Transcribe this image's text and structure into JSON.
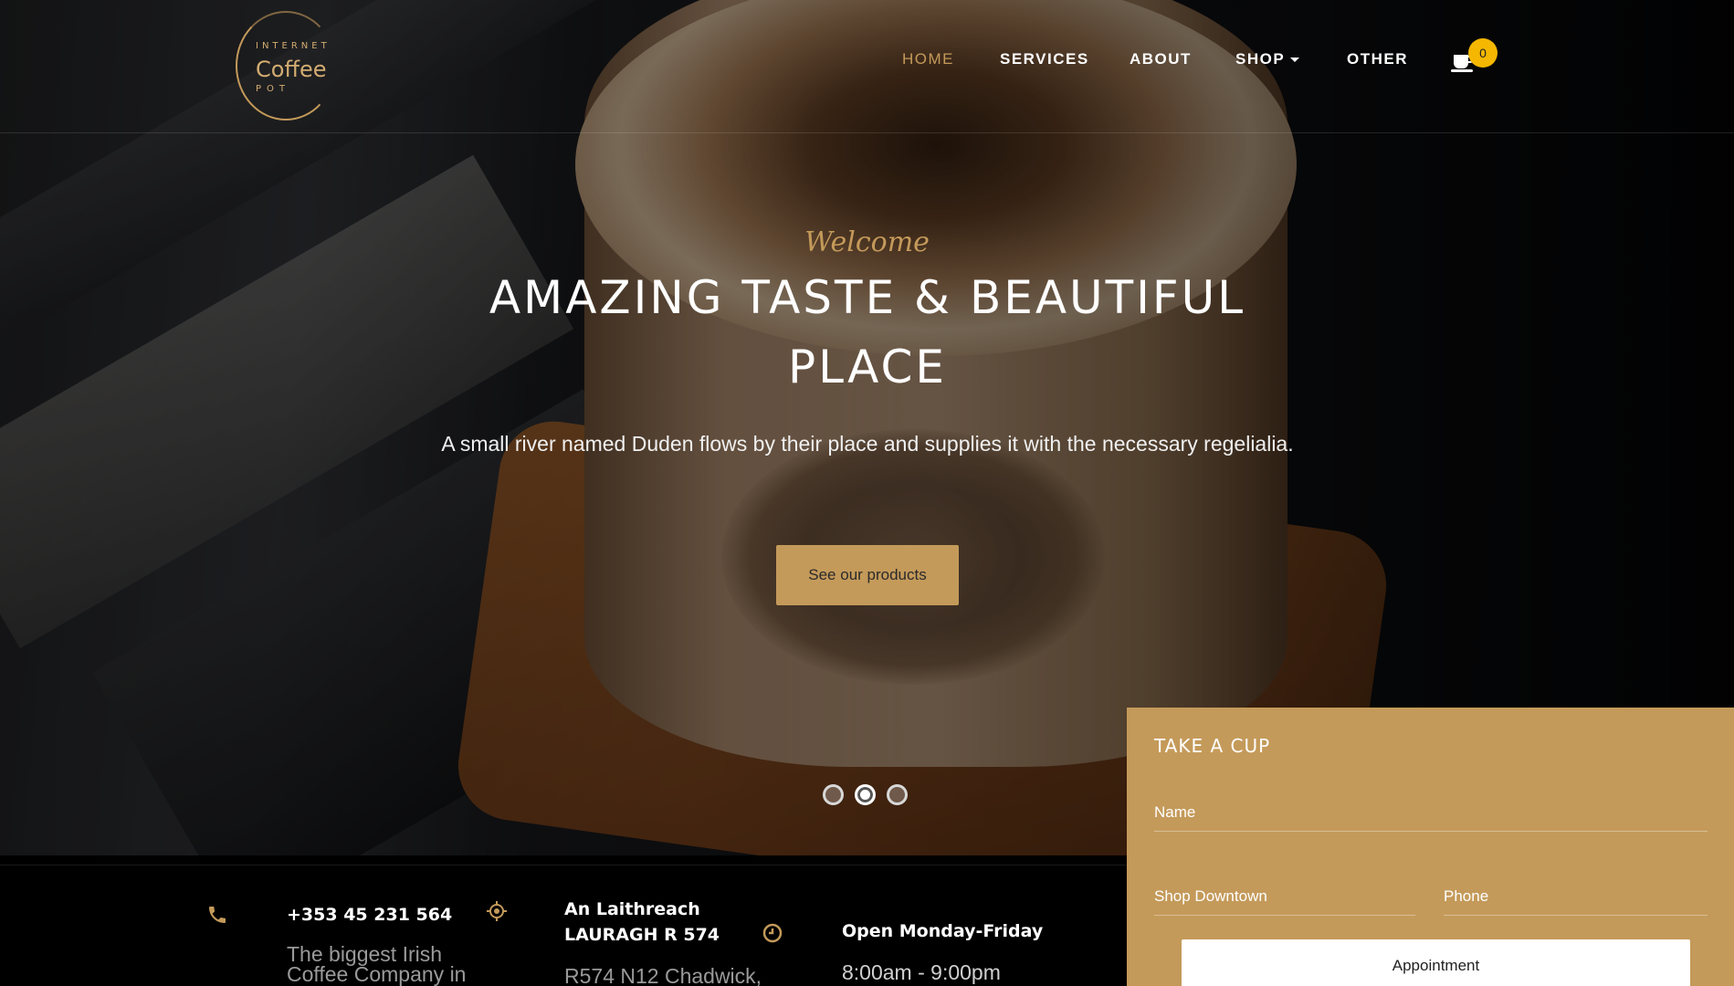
{
  "brand": {
    "line1": "INTERNET",
    "line2": "Coffee",
    "line3": "POT"
  },
  "nav": {
    "items": [
      {
        "label": "HOME"
      },
      {
        "label": "SERVICES"
      },
      {
        "label": "ABOUT"
      },
      {
        "label": "SHOP"
      },
      {
        "label": "OTHER"
      }
    ],
    "active": "HOME",
    "cart_count": "0"
  },
  "hero": {
    "welcome": "Welcome",
    "headline": "AMAZING TASTE & BEAUTIFUL PLACE",
    "subtitle": "A small river named Duden flows by their place and supplies it with the necessary regelialia.",
    "cta_label": "See our products",
    "slides_total": 3,
    "active_slide": 2
  },
  "info": {
    "phone": {
      "icon": "phone-icon",
      "number": "+353 45 231 564",
      "tagline": "The biggest Irish Coffee Company in the World"
    },
    "address": {
      "icon": "location-icon",
      "line1": "An Laithreach",
      "line2": "LAURAGH R 574",
      "line3": "R574 N12 Chadwick,"
    },
    "hours": {
      "icon": "clock-icon",
      "title": "Open Monday-Friday",
      "time": "8:00am - 9:00pm"
    }
  },
  "booking": {
    "title": "TAKE A CUP",
    "name_placeholder": "Name",
    "shop_placeholder": "Shop Downtown",
    "phone_placeholder": "Phone",
    "button_label": "Appointment"
  },
  "colors": {
    "accent": "#c49a5a",
    "badge": "#f5b700",
    "background": "#000000"
  }
}
